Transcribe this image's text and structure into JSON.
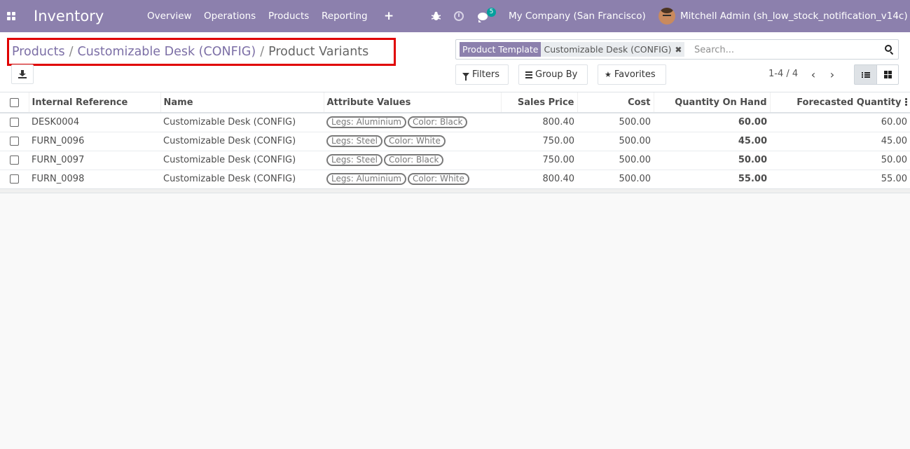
{
  "navbar": {
    "app_title": "Inventory",
    "menu": [
      "Overview",
      "Operations",
      "Products",
      "Reporting"
    ],
    "add_icon": "plus-icon",
    "debug_icon": "bug-icon",
    "activity_icon": "clock-icon",
    "messages_icon": "chat-icon",
    "messages_badge": "5",
    "company": "My Company (San Francisco)",
    "user": "Mitchell Admin (sh_low_stock_notification_v14c)",
    "accent_color": "#8c80ad"
  },
  "breadcrumb": {
    "items": [
      "Products",
      "Customizable Desk (CONFIG)"
    ],
    "separator": "/",
    "current": "Product Variants"
  },
  "search": {
    "facet_label": "Product Template",
    "facet_value": "Customizable Desk (CONFIG)",
    "facet_remove": "✖",
    "placeholder": "Search..."
  },
  "controls": {
    "filters": "Filters",
    "group_by": "Group By",
    "favorites": "Favorites",
    "pager": "1-4 / 4",
    "prev": "‹",
    "next": "›"
  },
  "table": {
    "headers": [
      "Internal Reference",
      "Name",
      "Attribute Values",
      "Sales Price",
      "Cost",
      "Quantity On Hand",
      "Forecasted Quantity"
    ],
    "rows": [
      {
        "ref": "DESK0004",
        "name": "Customizable Desk (CONFIG)",
        "attrs": [
          "Legs: Aluminium",
          "Color: Black"
        ],
        "price": "800.40",
        "cost": "500.00",
        "qty": "60.00",
        "forecast": "60.00"
      },
      {
        "ref": "FURN_0096",
        "name": "Customizable Desk (CONFIG)",
        "attrs": [
          "Legs: Steel",
          "Color: White"
        ],
        "price": "750.00",
        "cost": "500.00",
        "qty": "45.00",
        "forecast": "45.00"
      },
      {
        "ref": "FURN_0097",
        "name": "Customizable Desk (CONFIG)",
        "attrs": [
          "Legs: Steel",
          "Color: Black"
        ],
        "price": "750.00",
        "cost": "500.00",
        "qty": "50.00",
        "forecast": "50.00"
      },
      {
        "ref": "FURN_0098",
        "name": "Customizable Desk (CONFIG)",
        "attrs": [
          "Legs: Aluminium",
          "Color: White"
        ],
        "price": "800.40",
        "cost": "500.00",
        "qty": "55.00",
        "forecast": "55.00"
      }
    ]
  },
  "highlight_color": "#e00000"
}
